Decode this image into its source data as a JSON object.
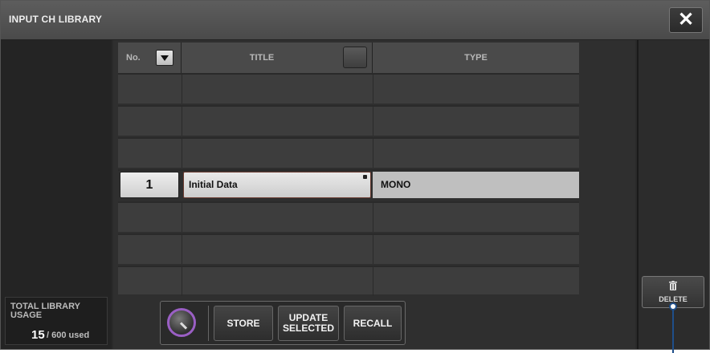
{
  "window": {
    "title": "INPUT CH LIBRARY",
    "close_glyph": "✕"
  },
  "table": {
    "headers": {
      "no": "No.",
      "title": "TITLE",
      "type": "TYPE"
    },
    "rows": [
      {
        "no": "",
        "title": "",
        "type": ""
      },
      {
        "no": "",
        "title": "",
        "type": ""
      },
      {
        "no": "",
        "title": "",
        "type": ""
      },
      {
        "no": "1",
        "title": "Initial Data",
        "type": "MONO",
        "selected": true
      },
      {
        "no": "",
        "title": "",
        "type": ""
      },
      {
        "no": "",
        "title": "",
        "type": ""
      },
      {
        "no": "",
        "title": "",
        "type": ""
      }
    ]
  },
  "usage": {
    "label": "TOTAL LIBRARY USAGE",
    "count": "15",
    "total": "/ 600 used"
  },
  "actions": {
    "store": "STORE",
    "update_line1": "UPDATE",
    "update_line2": "SELECTED",
    "recall": "RECALL",
    "knob_icon": "rotary-knob-icon"
  },
  "delete": {
    "label": "DELETE",
    "icon": "trash-icon"
  },
  "colors": {
    "knob_ring": "#9a5fc4",
    "callout": "#1f4f8a"
  }
}
